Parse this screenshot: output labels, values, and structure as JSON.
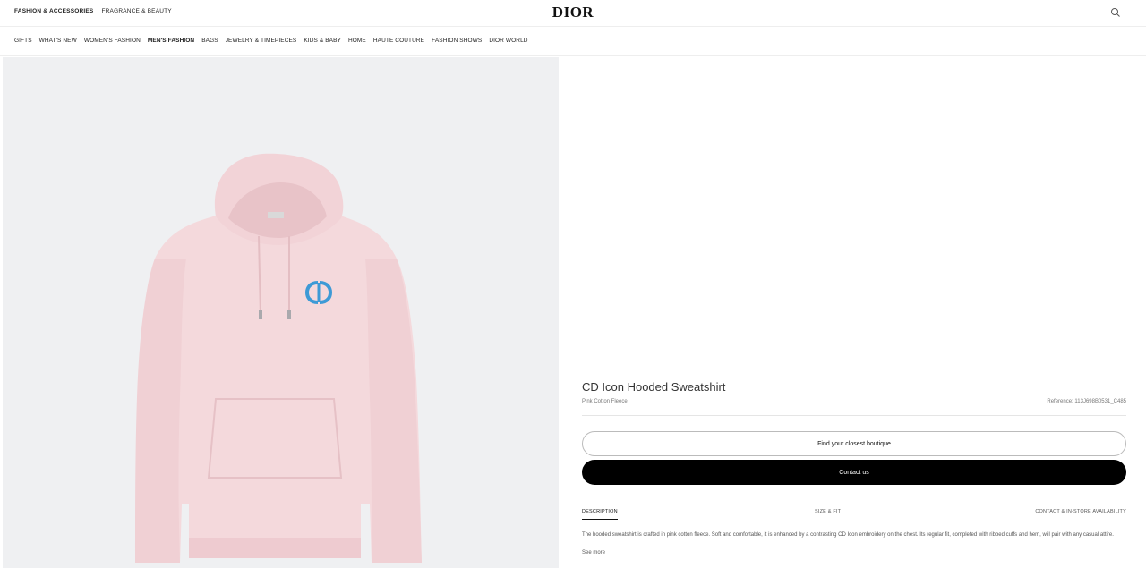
{
  "header": {
    "top_links": [
      "FASHION & ACCESSORIES",
      "FRAGRANCE & BEAUTY"
    ],
    "logo": "DIOR",
    "search_icon": "search-icon"
  },
  "nav": {
    "items": [
      "GIFTS",
      "WHAT'S NEW",
      "WOMEN'S FASHION",
      "MEN'S FASHION",
      "BAGS",
      "JEWELRY & TIMEPIECES",
      "KIDS & BABY",
      "HOME",
      "HAUTE COUTURE",
      "FASHION SHOWS",
      "DIOR WORLD"
    ],
    "active_item": "MEN'S FASHION"
  },
  "product": {
    "title": "CD Icon Hooded Sweatshirt",
    "subtitle": "Pink Cotton Fleece",
    "reference": "Reference: 113J698B0531_C485",
    "image": "pink-hooded-sweatshirt",
    "colors": {
      "garment": "#f4d9dc",
      "emblem": "#3d9ad6",
      "background": "#eff0f2"
    }
  },
  "actions": {
    "find_boutique": "Find your closest boutique",
    "contact": "Contact us"
  },
  "tabs": [
    "DESCRIPTION",
    "SIZE & FIT",
    "CONTACT & IN-STORE AVAILABILITY"
  ],
  "description": {
    "text": "The hooded sweatshirt is crafted in pink cotton fleece. Soft and comfortable, it is enhanced by a contrasting CD Icon embroidery on the chest. Its regular fit, completed with ribbed cuffs and hem, will pair with any casual attire.",
    "see_more": "See more"
  }
}
